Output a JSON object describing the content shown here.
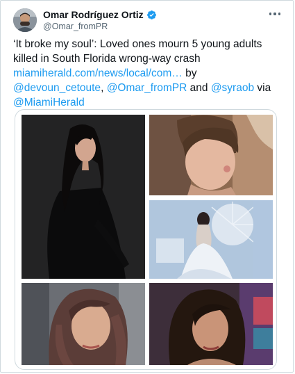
{
  "tweet": {
    "author_name": "Omar Rodríguez Ortiz",
    "author_handle": "@Omar_fromPR",
    "text_intro": "‘It broke my soul’: Loved ones mourn 5 young adults killed in South Florida wrong-way crash",
    "link": "miamiherald.com/news/local/com…",
    "by": " by",
    "mention_1": "@devoun_cetoute",
    "sep_1": ", ",
    "mention_2": "@Omar_fromPR",
    "and": " and ",
    "mention_3": "@syraob",
    "via": " via",
    "mention_4": "@MiamiHerald"
  },
  "icons": {
    "verified": "verified-badge-icon",
    "more": "more-options-icon"
  },
  "colors": {
    "link": "#1d9bf0",
    "text": "#0f1419",
    "secondary": "#536471",
    "border": "#cfd9de"
  }
}
